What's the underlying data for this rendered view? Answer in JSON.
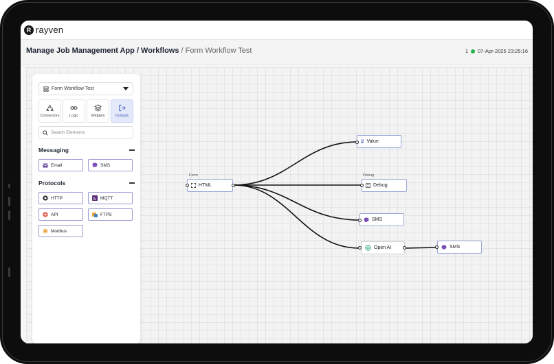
{
  "app": {
    "logo_text": "rayven",
    "logo_letter": "R"
  },
  "breadcrumb": {
    "path": "Manage Job Management App / Workflows",
    "separator": " / ",
    "current": "Form Workflow Test"
  },
  "status": {
    "count": "1",
    "timestamp": "07-Apr-2025 23:25:16",
    "dot_color": "#22b04b"
  },
  "panel": {
    "workflow_select": "Form Workflow Test",
    "tabs": [
      {
        "label": "Connectors",
        "icon": "recycle-icon"
      },
      {
        "label": "Logic",
        "icon": "link-icon"
      },
      {
        "label": "Widgets",
        "icon": "layers-icon"
      },
      {
        "label": "Outputs",
        "icon": "output-icon",
        "active": true
      }
    ],
    "search_placeholder": "Search Elements",
    "sections": {
      "messaging": {
        "title": "Messaging",
        "items": [
          "Email",
          "SMS"
        ]
      },
      "protocols": {
        "title": "Protocols",
        "items": [
          "HTTP",
          "MQTT",
          "API",
          "FTPS",
          "Modbus"
        ]
      }
    }
  },
  "nodes": {
    "form": {
      "caption": "Form",
      "label": "HTML"
    },
    "value": {
      "label": "Value"
    },
    "debug": {
      "caption": "Debug",
      "label": "Debug"
    },
    "sms1": {
      "label": "SMS"
    },
    "openai": {
      "label": "Open AI"
    },
    "sms2": {
      "label": "SMS"
    }
  },
  "colors": {
    "accent": "#3a56b8",
    "node_border": "#9aa7d8",
    "chip_border": "#9a9ad4",
    "edge": "#111111"
  }
}
